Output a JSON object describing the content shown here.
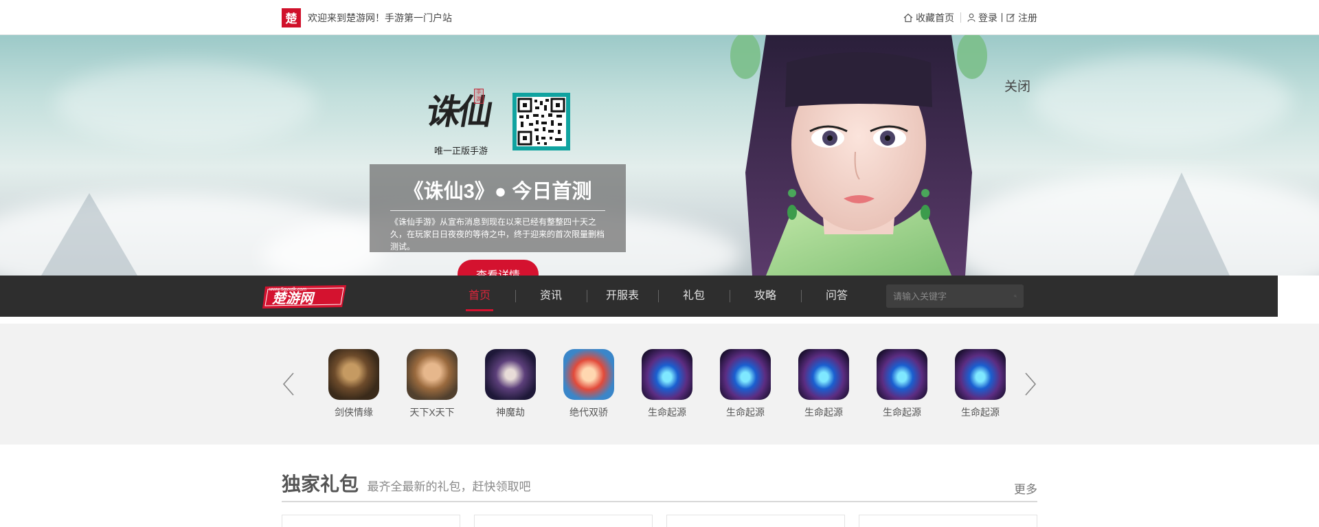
{
  "topbar": {
    "logo_char": "楚",
    "welcome": "欢迎来到楚游网！手游第一门户站",
    "bookmark": "收藏首页",
    "login": "登录",
    "register": "注册"
  },
  "banner": {
    "close": "关闭",
    "game_logo_text": "诛仙",
    "game_logo_seal": "手游",
    "game_logo_sub": "唯一正版手游",
    "promo_title": "《诛仙3》● 今日首测",
    "promo_desc": "《诛仙手游》从宣布消息到现在以来已经有整整四十天之久，在玩家日日夜夜的等待之中，终于迎来的首次限量删档测试。",
    "detail_button": "查看详情"
  },
  "nav": {
    "logo_text": "楚游网",
    "logo_url_text": "www.5ayxdk.com",
    "items": [
      {
        "label": "首页",
        "active": true
      },
      {
        "label": "资讯",
        "active": false
      },
      {
        "label": "开服表",
        "active": false
      },
      {
        "label": "礼包",
        "active": false
      },
      {
        "label": "攻略",
        "active": false
      },
      {
        "label": "问答",
        "active": false
      }
    ],
    "search_placeholder": "请输入关键字"
  },
  "games": [
    {
      "name": "剑侠情缘",
      "icon": "gi-a"
    },
    {
      "name": "天下X天下",
      "icon": "gi-b"
    },
    {
      "name": "神魔劫",
      "icon": "gi-c"
    },
    {
      "name": "绝代双骄",
      "icon": "gi-d"
    },
    {
      "name": "生命起源",
      "icon": "gi-e"
    },
    {
      "name": "生命起源",
      "icon": "gi-e"
    },
    {
      "name": "生命起源",
      "icon": "gi-e"
    },
    {
      "name": "生命起源",
      "icon": "gi-e"
    },
    {
      "name": "生命起源",
      "icon": "gi-e"
    }
  ],
  "gift": {
    "title": "独家礼包",
    "subtitle": "最齐全最新的礼包，赶快领取吧",
    "more": "更多"
  },
  "colors": {
    "brand_red": "#d4122f",
    "nav_bg": "#2e2e2e",
    "strip_bg": "#f2f2f2"
  }
}
